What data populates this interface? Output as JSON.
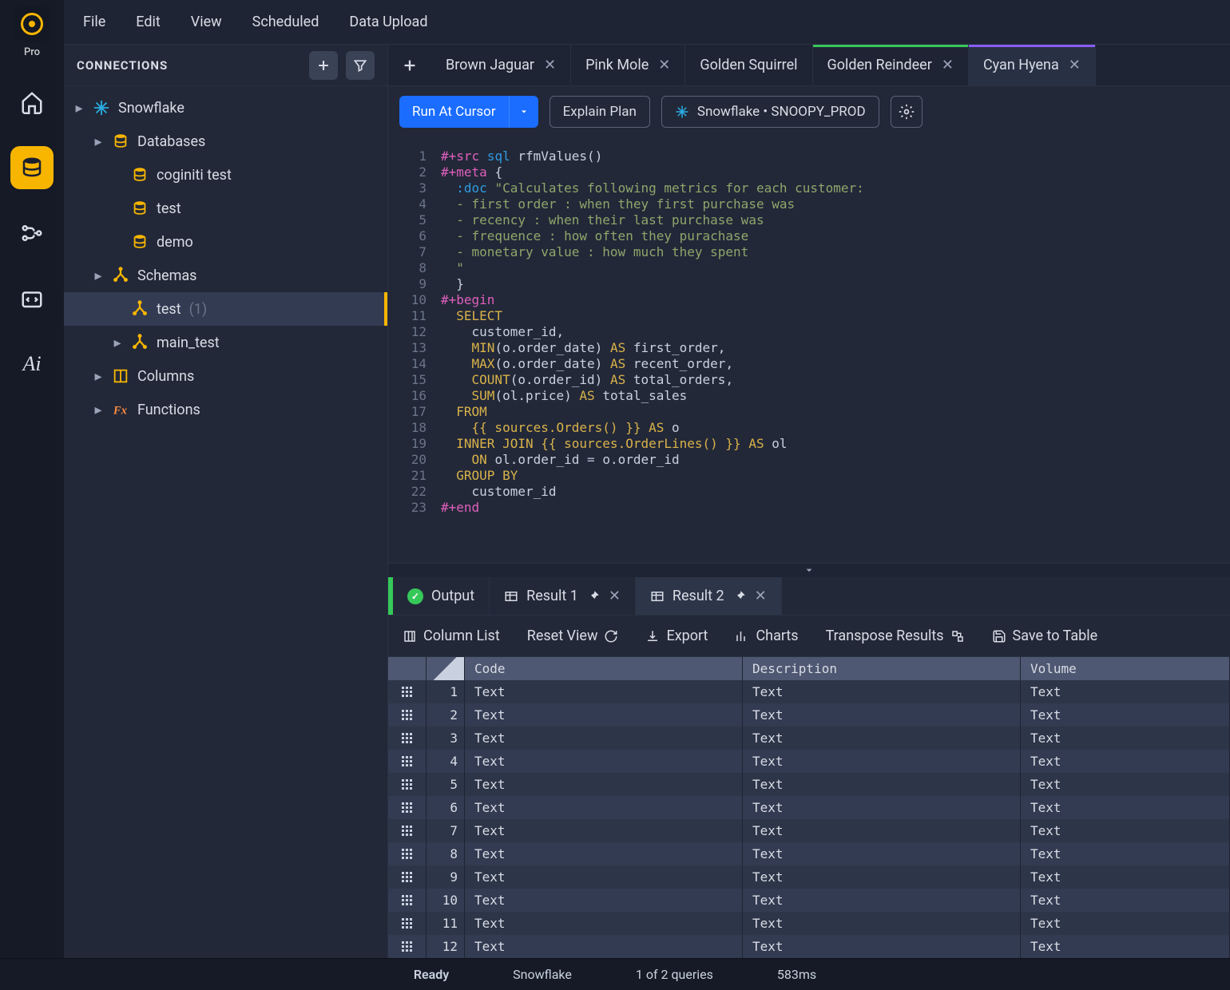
{
  "app": {
    "pro_label": "Pro"
  },
  "menubar": [
    "File",
    "Edit",
    "View",
    "Scheduled",
    "Data Upload"
  ],
  "connections": {
    "title": "CONNECTIONS",
    "tree": [
      {
        "label": "Snowflake",
        "indent": 0,
        "caret": true,
        "icon": "snowflake"
      },
      {
        "label": "Databases",
        "indent": 1,
        "caret": true,
        "icon": "database"
      },
      {
        "label": "coginiti test",
        "indent": 2,
        "caret": false,
        "icon": "database"
      },
      {
        "label": "test",
        "indent": 2,
        "caret": false,
        "icon": "database"
      },
      {
        "label": "demo",
        "indent": 2,
        "caret": false,
        "icon": "database"
      },
      {
        "label": "Schemas",
        "indent": 1,
        "caret": true,
        "icon": "schema"
      },
      {
        "label": "test",
        "suffix": "(1)",
        "indent": 2,
        "caret": false,
        "icon": "schema",
        "selected": true
      },
      {
        "label": "main_test",
        "indent": 2,
        "caret": true,
        "icon": "schema"
      },
      {
        "label": "Columns",
        "indent": 1,
        "caret": true,
        "icon": "columns"
      },
      {
        "label": "Functions",
        "indent": 1,
        "caret": true,
        "icon": "function"
      }
    ]
  },
  "tabs": [
    {
      "label": "Brown Jaguar",
      "accent": null
    },
    {
      "label": "Pink Mole",
      "accent": null
    },
    {
      "label": "Golden Squirrel",
      "accent": null,
      "noclose": true
    },
    {
      "label": "Golden Reindeer",
      "accent": "#37c85a"
    },
    {
      "label": "Cyan Hyena",
      "accent": "#8a5cf6",
      "active": true
    }
  ],
  "toolbar": {
    "run": "Run At Cursor",
    "explain": "Explain Plan",
    "conn": "Snowflake • SNOOPY_PROD"
  },
  "code": {
    "lines": 23
  },
  "result_tabs": {
    "output": "Output",
    "r1": "Result 1",
    "r2": "Result 2"
  },
  "result_toolbar": {
    "column_list": "Column List",
    "reset": "Reset View",
    "export": "Export",
    "charts": "Charts",
    "transpose": "Transpose Results",
    "save": "Save to Table"
  },
  "grid": {
    "headers": [
      "Code",
      "Description",
      "Volume"
    ],
    "rows": [
      {
        "n": 1,
        "cells": [
          "Text",
          "Text",
          "Text"
        ]
      },
      {
        "n": 2,
        "cells": [
          "Text",
          "Text",
          "Text"
        ]
      },
      {
        "n": 3,
        "cells": [
          "Text",
          "Text",
          "Text"
        ]
      },
      {
        "n": 4,
        "cells": [
          "Text",
          "Text",
          "Text"
        ]
      },
      {
        "n": 5,
        "cells": [
          "Text",
          "Text",
          "Text"
        ]
      },
      {
        "n": 6,
        "cells": [
          "Text",
          "Text",
          "Text"
        ]
      },
      {
        "n": 7,
        "cells": [
          "Text",
          "Text",
          "Text"
        ]
      },
      {
        "n": 8,
        "cells": [
          "Text",
          "Text",
          "Text"
        ]
      },
      {
        "n": 9,
        "cells": [
          "Text",
          "Text",
          "Text"
        ]
      },
      {
        "n": 10,
        "cells": [
          "Text",
          "Text",
          "Text"
        ]
      },
      {
        "n": 11,
        "cells": [
          "Text",
          "Text",
          "Text"
        ]
      },
      {
        "n": 12,
        "cells": [
          "Text",
          "Text",
          "Text"
        ]
      }
    ]
  },
  "status": {
    "ready": "Ready",
    "conn": "Snowflake",
    "queries": "1 of 2 queries",
    "time": "583ms"
  }
}
